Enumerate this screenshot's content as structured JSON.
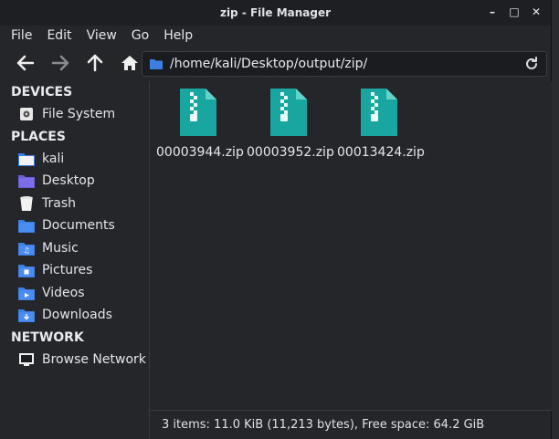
{
  "window": {
    "title": "zip - File Manager"
  },
  "menu": [
    "File",
    "Edit",
    "View",
    "Go",
    "Help"
  ],
  "address": {
    "path": "/home/kali/Desktop/output/zip/"
  },
  "sidebar": {
    "devices_header": "DEVICES",
    "devices": [
      {
        "label": "File System",
        "icon": "harddisk-icon"
      }
    ],
    "places_header": "PLACES",
    "places": [
      {
        "label": "kali",
        "icon": "home-folder-icon"
      },
      {
        "label": "Desktop",
        "icon": "desktop-folder-icon"
      },
      {
        "label": "Trash",
        "icon": "trash-icon"
      },
      {
        "label": "Documents",
        "icon": "documents-folder-icon"
      },
      {
        "label": "Music",
        "icon": "music-folder-icon"
      },
      {
        "label": "Pictures",
        "icon": "pictures-folder-icon"
      },
      {
        "label": "Videos",
        "icon": "videos-folder-icon"
      },
      {
        "label": "Downloads",
        "icon": "downloads-folder-icon"
      }
    ],
    "network_header": "NETWORK",
    "network": [
      {
        "label": "Browse Network",
        "icon": "network-icon"
      }
    ]
  },
  "files": [
    {
      "name": "00003944.zip",
      "icon": "zip-archive-icon"
    },
    {
      "name": "00003952.zip",
      "icon": "zip-archive-icon"
    },
    {
      "name": "00013424.zip",
      "icon": "zip-archive-icon"
    }
  ],
  "status": "3 items: 11.0 KiB (11,213 bytes), Free space: 64.2 GiB",
  "colors": {
    "folder": "#3d7fe0",
    "zip": "#1aa6a0",
    "background": "#24262a"
  }
}
